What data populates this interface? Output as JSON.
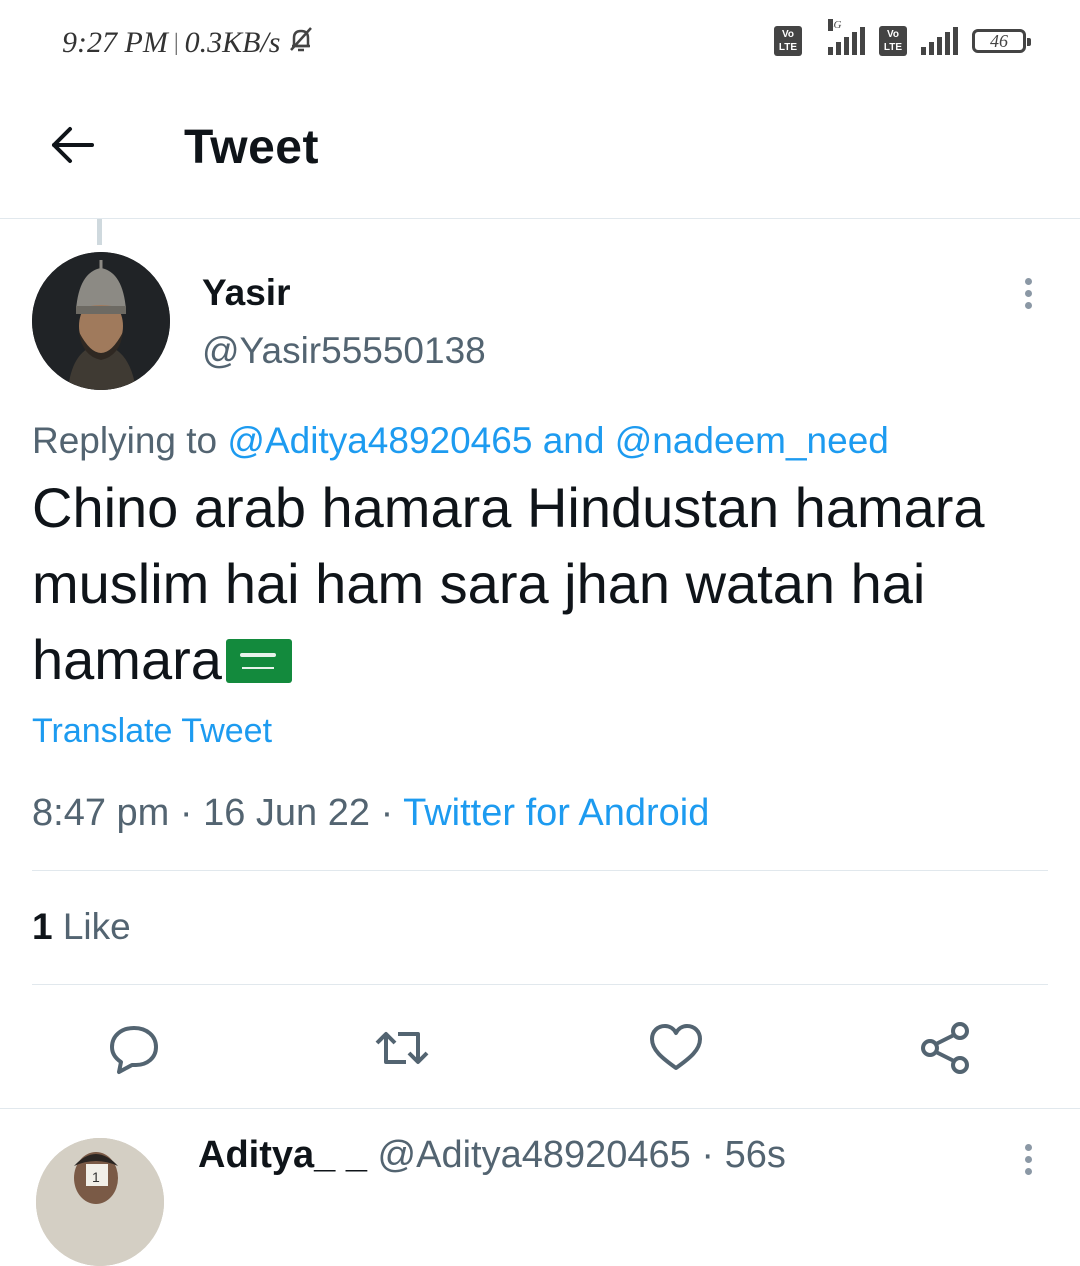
{
  "status_bar": {
    "time": "9:27 PM",
    "speed": "0.3KB/s",
    "volte1": "Vo LTE",
    "network": "4G",
    "volte2": "Vo LTE",
    "battery": "46"
  },
  "header": {
    "title": "Tweet"
  },
  "tweet": {
    "author_name": "Yasir",
    "author_handle": "@Yasir55550138",
    "replying_prefix": "Replying to",
    "mention1": "@Aditya48920465",
    "and_text": "and",
    "mention2": "@nadeem_need",
    "text": "Chino arab hamara Hindustan hamara muslim hai ham sara jhan watan hai hamara",
    "translate_label": "Translate Tweet",
    "time": "8:47 pm",
    "date": "16 Jun 22",
    "source": "Twitter for Android",
    "like_count": "1",
    "like_label": "Like",
    "flag_icon": "saudi-flag-emoji"
  },
  "actions": [
    "reply",
    "retweet",
    "like",
    "share"
  ],
  "reply_preview": {
    "name": "Aditya_ _",
    "handle": "@Aditya48920465",
    "time": "56s"
  },
  "colors": {
    "link": "#1d9bf0",
    "secondary_text": "#536471",
    "divider": "#e1e8ed"
  }
}
